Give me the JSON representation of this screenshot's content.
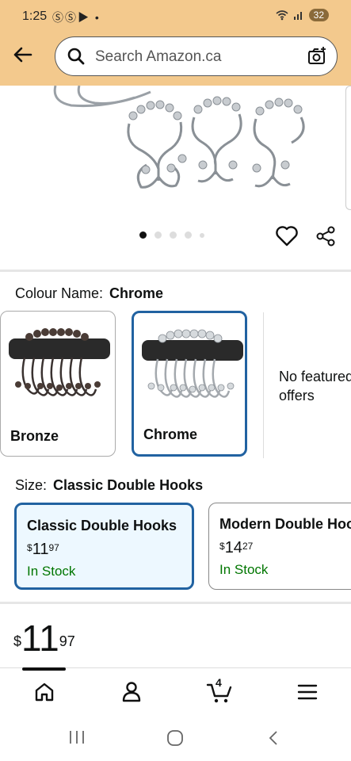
{
  "status": {
    "time": "1:25",
    "icons": "ⓈⓈ▶ •",
    "battery": "32"
  },
  "search": {
    "placeholder": "Search Amazon.ca"
  },
  "gallery": {
    "image_count": 5,
    "active_index": 0
  },
  "colour": {
    "label": "Colour Name:",
    "selected": "Chrome",
    "options": [
      {
        "name": "Bronze",
        "color": "#3a3230"
      },
      {
        "name": "Chrome",
        "color": "#bfc3c7"
      }
    ],
    "no_featured": "No featured offers"
  },
  "size": {
    "label": "Size:",
    "selected": "Classic Double Hooks",
    "options": [
      {
        "title": "Classic Double Hooks",
        "price_whole": "11",
        "price_cents": "97",
        "currency": "$",
        "stock": "In Stock"
      },
      {
        "title": "Modern Double Hooks",
        "price_whole": "14",
        "price_cents": "27",
        "currency": "$",
        "stock": "In Stock"
      }
    ]
  },
  "price": {
    "currency": "$",
    "whole": "11",
    "cents": "97"
  },
  "nav": {
    "cart_count": "4"
  }
}
